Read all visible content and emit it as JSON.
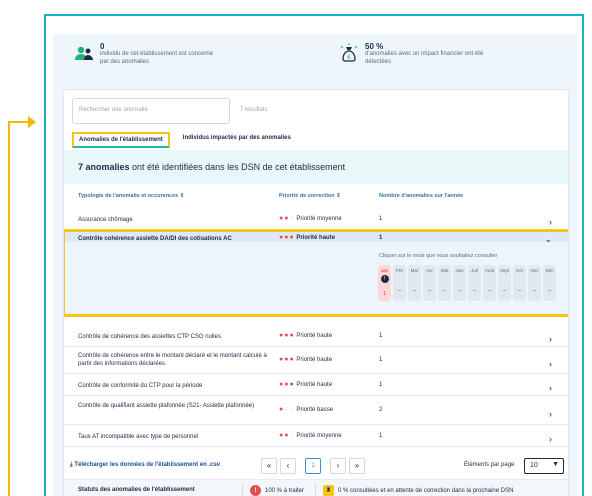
{
  "stats": [
    {
      "value": "0",
      "text": "individu de cet établissement est concerné par des anomalies",
      "icon": "people-icon"
    },
    {
      "value": "50 %",
      "text": "d'anomalies avec un impact financier ont été détectées",
      "icon": "money-bag-icon"
    }
  ],
  "search": {
    "placeholder": "Rechercher une anomalie",
    "results": "7 résultats"
  },
  "tabs": [
    {
      "label": "Anomalies de l'établissement",
      "active": true
    },
    {
      "label": "Individus impactés par des anomalies",
      "active": false
    }
  ],
  "headline": {
    "count": "7 anomalies",
    "text": " ont été identifiées dans les DSN de cet établissement"
  },
  "table": {
    "headers": [
      "Typologie de l'anomalie et occurences ⇕",
      "Priorité de correction ⇕",
      "Nombre d'anomalies sur l'année"
    ],
    "rows": [
      {
        "label": "Assurance chômage",
        "priority": "Priorité moyenne",
        "level": 2,
        "count": "1"
      },
      {
        "label": "Contrôle cohérence assiette DA/DI des cotisations AC",
        "priority": "Priorité haute",
        "level": 3,
        "count": "1",
        "expanded": true
      },
      {
        "label": "Contrôle de cohérence des assiettes CTP CSG nulles",
        "priority": "Priorité haute",
        "level": 3,
        "count": "1"
      },
      {
        "label": "Contrôle de cohérence entre le montant déclaré et le montant calculé à partir des informations déclarées",
        "priority": "Priorité haute",
        "level": 3,
        "count": "1"
      },
      {
        "label": "Contrôle de conformité du CTP pour la période",
        "priority": "Priorité haute",
        "level": 3,
        "count": "1"
      },
      {
        "label": "Contrôle de qualifiant assiette plafonnée (S21- Assiette plafonnée)",
        "priority": "Priorité basse",
        "level": 1,
        "count": "2"
      },
      {
        "label": "Taux AT incompatible avec type de personnel",
        "priority": "Priorité moyenne",
        "level": 2,
        "count": "1"
      }
    ]
  },
  "expand": {
    "hint": "Cliquer sur le mois que vous souhaitez consulter",
    "months": [
      {
        "label": "Jan",
        "value": "1",
        "active": true
      },
      {
        "label": "Fév",
        "value": "–"
      },
      {
        "label": "Mar",
        "value": "–"
      },
      {
        "label": "Avr",
        "value": "–"
      },
      {
        "label": "Mai",
        "value": "–"
      },
      {
        "label": "Juin",
        "value": "–"
      },
      {
        "label": "Juil",
        "value": "–"
      },
      {
        "label": "Août",
        "value": "–"
      },
      {
        "label": "Sept",
        "value": "–"
      },
      {
        "label": "Oct",
        "value": "–"
      },
      {
        "label": "Nov",
        "value": "–"
      },
      {
        "label": "Déc",
        "value": "–"
      }
    ],
    "badge": "!"
  },
  "footer": {
    "download": "⤓  Télécharger les données de l'établissement en .csv",
    "pager": {
      "first": "«",
      "prev": "‹",
      "current": "1",
      "next": "›",
      "last": "»"
    },
    "per_page_label": "Éléments par page",
    "per_page_value": "10",
    "caret": "▼"
  },
  "status": {
    "title": "Statuts des anomalies de l'établissement",
    "items": [
      {
        "icon": "!",
        "text": "100 % à traiter"
      },
      {
        "icon": "⧗",
        "text": "0 % consultées et en attente de correction dans la prochaine DSN"
      }
    ]
  },
  "colors": {
    "accent": "#18b4c4",
    "highlight": "#f5c518",
    "danger": "#e05252",
    "link": "#1f4e8c"
  }
}
